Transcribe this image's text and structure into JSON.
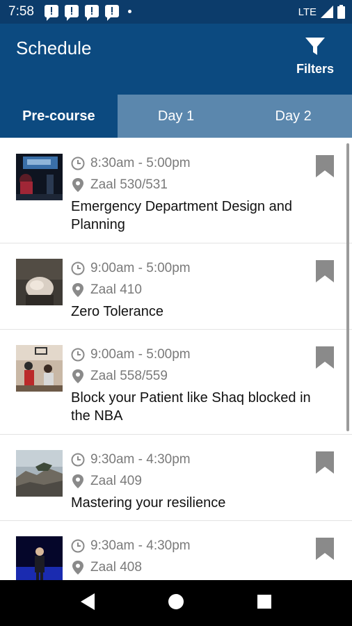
{
  "status": {
    "time": "7:58",
    "network": "LTE"
  },
  "app": {
    "title": "Schedule",
    "filters_label": "Filters"
  },
  "tabs": [
    {
      "label": "Pre-course",
      "active": true
    },
    {
      "label": "Day 1",
      "active": false
    },
    {
      "label": "Day 2",
      "active": false
    }
  ],
  "sessions": [
    {
      "time": "8:30am - 5:00pm",
      "location": "Zaal 530/531",
      "title": "Emergency Department Design and Planning"
    },
    {
      "time": "9:00am - 5:00pm",
      "location": "Zaal 410",
      "title": "Zero Tolerance"
    },
    {
      "time": "9:00am - 5:00pm",
      "location": "Zaal 558/559",
      "title": "Block your Patient like Shaq blocked in the NBA"
    },
    {
      "time": "9:30am - 4:30pm",
      "location": "Zaal 409",
      "title": "Mastering your resilience"
    },
    {
      "time": "9:30am - 4:30pm",
      "location": "Zaal 408",
      "title": ""
    }
  ],
  "colors": {
    "primary": "#0c4a80",
    "statusbar": "#0c3c6b",
    "tab_inactive": "#5b87ad",
    "icon_gray": "#8a8a8a"
  },
  "icons": [
    "filter-icon",
    "clock-icon",
    "location-pin-icon",
    "bookmark-icon",
    "back-icon",
    "home-icon",
    "recents-icon"
  ]
}
